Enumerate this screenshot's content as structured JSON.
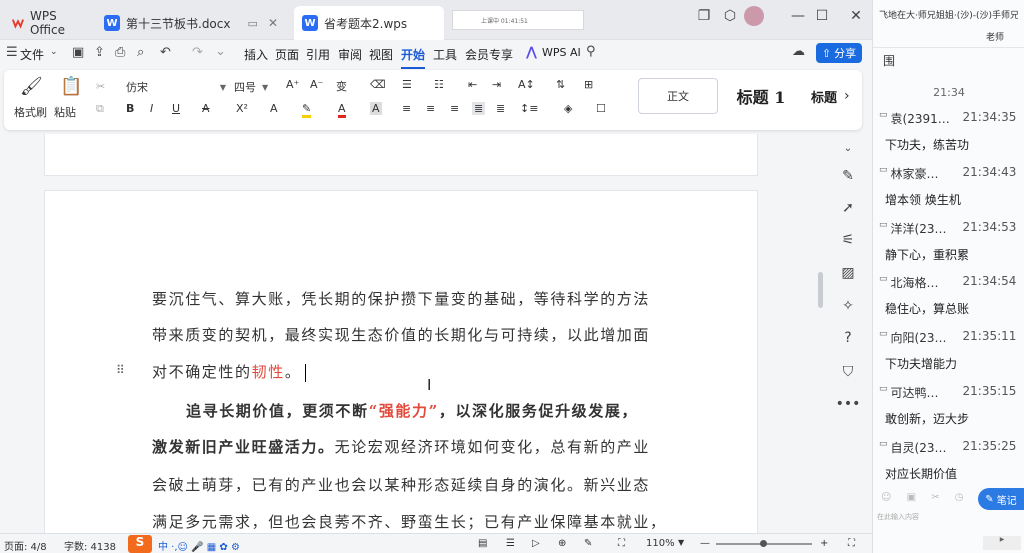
{
  "app": {
    "name": "WPS Office"
  },
  "tabs": [
    {
      "label": "第十三节板书.docx"
    },
    {
      "label": "省考题本2.wps"
    }
  ],
  "recording": {
    "text": "上课中 01:41:51"
  },
  "menu": {
    "file": "文件",
    "items": [
      "插入",
      "页面",
      "引用",
      "审阅",
      "视图",
      "开始",
      "工具",
      "会员专享"
    ],
    "active": "开始",
    "ai": "WPS AI",
    "share": "分享"
  },
  "ribbon": {
    "format_painter": "格式刷",
    "paste": "粘贴",
    "font": "仿宋",
    "size": "四号",
    "style_normal": "正文",
    "style_h1": "标题 1",
    "style_h": "标题"
  },
  "doc": {
    "lines": [
      {
        "text": "要沉住气、算大账，凭长期的保护攒下量变的基础，等待科学的方法"
      },
      {
        "text": "带来质变的契机，最终实现生态价值的长期化与可持续，以此增加面"
      },
      {
        "pre": "对不确定性的",
        "red": "韧性",
        "post": "。"
      },
      {
        "b1": "追寻长期价值，更须不断",
        "bq": "“强能力”",
        "b2": "，以深化服务促升级发展，"
      },
      {
        "b": "激发新旧产业旺盛活力。",
        "n": "无论宏观经济环境如何变化，总有新的产业"
      },
      {
        "text": "会破土萌芽，已有的产业也会以某种形态延续自身的演化。新兴业态"
      },
      {
        "text": "满足多元需求，但也会良莠不齐、野蛮生长；已有产业保障基本就业，"
      }
    ]
  },
  "status": {
    "page": "页面: 4/8",
    "words": "字数: 4138",
    "zoom": "110%"
  },
  "chat": {
    "header": "飞地在大·师兄姐姐·(沙)-(沙)手师兄",
    "sub": "老师",
    "first": "围",
    "time_sep": "21:34",
    "messages": [
      {
        "name": "袁(2391…",
        "time": "21:34:35",
        "text": "下功夫，练苦功"
      },
      {
        "name": "林家豪…",
        "time": "21:34:43",
        "text": "增本领 焕生机"
      },
      {
        "name": "洋洋(23…",
        "time": "21:34:53",
        "text": "静下心，重积累"
      },
      {
        "name": "北海格…",
        "time": "21:34:54",
        "text": "稳住心，算总账"
      },
      {
        "name": "向阳(23…",
        "time": "21:35:11",
        "text": "下功夫增能力"
      },
      {
        "name": "可达鸭…",
        "time": "21:35:15",
        "text": "敢创新，迈大步"
      },
      {
        "name": "自灵(23…",
        "time": "21:35:25",
        "text": "对应长期价值"
      }
    ],
    "notes": "笔记",
    "input_hint": "在此输入内容"
  }
}
